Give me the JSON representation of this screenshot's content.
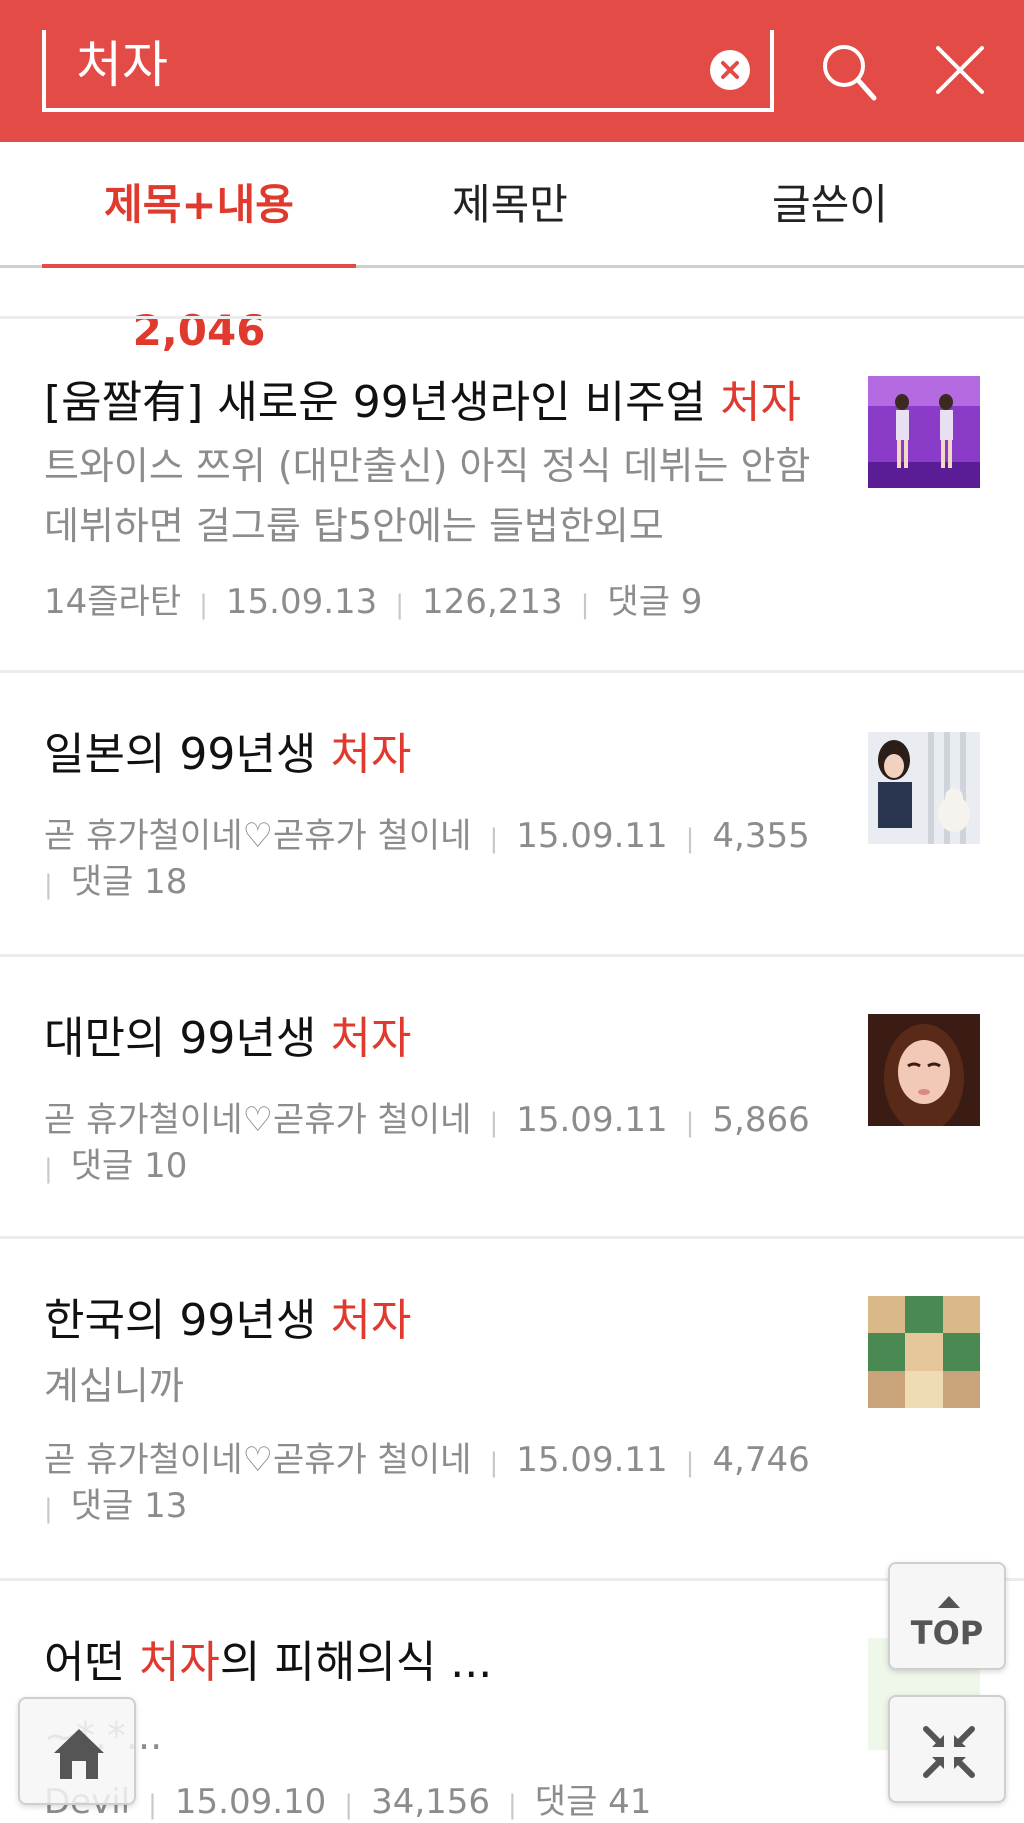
{
  "search": {
    "query": "처자"
  },
  "tabs": [
    {
      "label": "제목+내용 2,046",
      "active": true
    },
    {
      "label": "제목만",
      "active": false
    },
    {
      "label": "글쓴이",
      "active": false
    }
  ],
  "colors": {
    "accent": "#e34b47",
    "highlight": "#e03a2f",
    "meta": "#8c8c8c"
  },
  "posts": [
    {
      "title_pre": "[움짤有] 새로운 99년생라인 비주얼 ",
      "title_hl": "처자",
      "title_post": "",
      "snippet": "트와이스 쯔위 (대만출신) 아직 정식 데뷔는 안함 데뷔하면 걸그룹 탑5안에는 들법한외모",
      "author": "14즐라탄",
      "date": "15.09.13",
      "views": "126,213",
      "comments": "댓글 9"
    },
    {
      "title_pre": "일본의 99년생 ",
      "title_hl": "처자",
      "title_post": "",
      "snippet": "",
      "author": "곧 휴가철이네♡곧휴가 철이네",
      "date": "15.09.11",
      "views": "4,355",
      "comments": "댓글 18"
    },
    {
      "title_pre": "대만의 99년생 ",
      "title_hl": "처자",
      "title_post": "",
      "snippet": "",
      "author": "곧 휴가철이네♡곧휴가 철이네",
      "date": "15.09.11",
      "views": "5,866",
      "comments": "댓글 10"
    },
    {
      "title_pre": "한국의 99년생 ",
      "title_hl": "처자",
      "title_post": "",
      "snippet": "계십니까",
      "author": "곧 휴가철이네♡곧휴가 철이네",
      "date": "15.09.11",
      "views": "4,746",
      "comments": "댓글 13"
    },
    {
      "title_pre": "어떤 ",
      "title_hl": "처자",
      "title_post": "의 피해의식 ...",
      "snippet": "~*.*...",
      "author": "Devil",
      "date": "15.09.10",
      "views": "34,156",
      "comments": "댓글 41"
    }
  ],
  "fab": {
    "top_label": "TOP"
  }
}
